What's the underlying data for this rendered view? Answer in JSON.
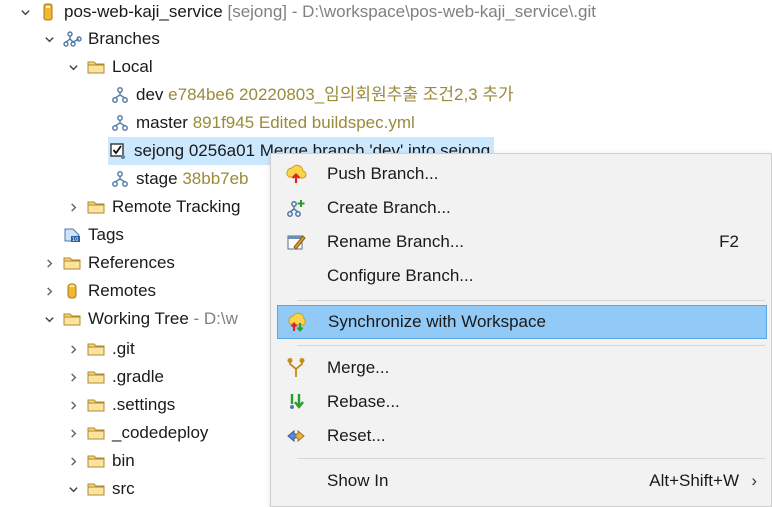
{
  "tree": {
    "repo": {
      "name": "pos-web-kaji_service",
      "meta": "[sejong] - D:\\workspace\\pos-web-kaji_service\\.git"
    },
    "branches": "Branches",
    "local": "Local",
    "local_branches": [
      {
        "name": "dev",
        "meta": "e784be6 20220803_임의회원추출 조건2,3 추가"
      },
      {
        "name": "master",
        "meta": "891f945 Edited buildspec.yml"
      },
      {
        "name": "sejong",
        "meta": "0256a01 Merge branch 'dev' into sejong"
      },
      {
        "name": "stage",
        "meta": "38bb7eb"
      }
    ],
    "remote_tracking": "Remote Tracking",
    "tags": "Tags",
    "references": "References",
    "remotes": "Remotes",
    "working_tree": {
      "name": "Working Tree",
      "meta": "- D:\\w"
    },
    "folders": [
      ".git",
      ".gradle",
      ".settings",
      "_codedeploy",
      "bin",
      "src"
    ]
  },
  "menu": {
    "push": "Push Branch...",
    "create": "Create Branch...",
    "rename": "Rename Branch...",
    "rename_key": "F2",
    "configure": "Configure Branch...",
    "synchronize": "Synchronize with Workspace",
    "merge": "Merge...",
    "rebase": "Rebase...",
    "reset": "Reset...",
    "show_in": "Show In",
    "show_in_key": "Alt+Shift+W"
  },
  "colors": {
    "selection": "#cce8ff",
    "menu_highlight": "#91c9f7",
    "meta_text": "#9a8a3a"
  }
}
